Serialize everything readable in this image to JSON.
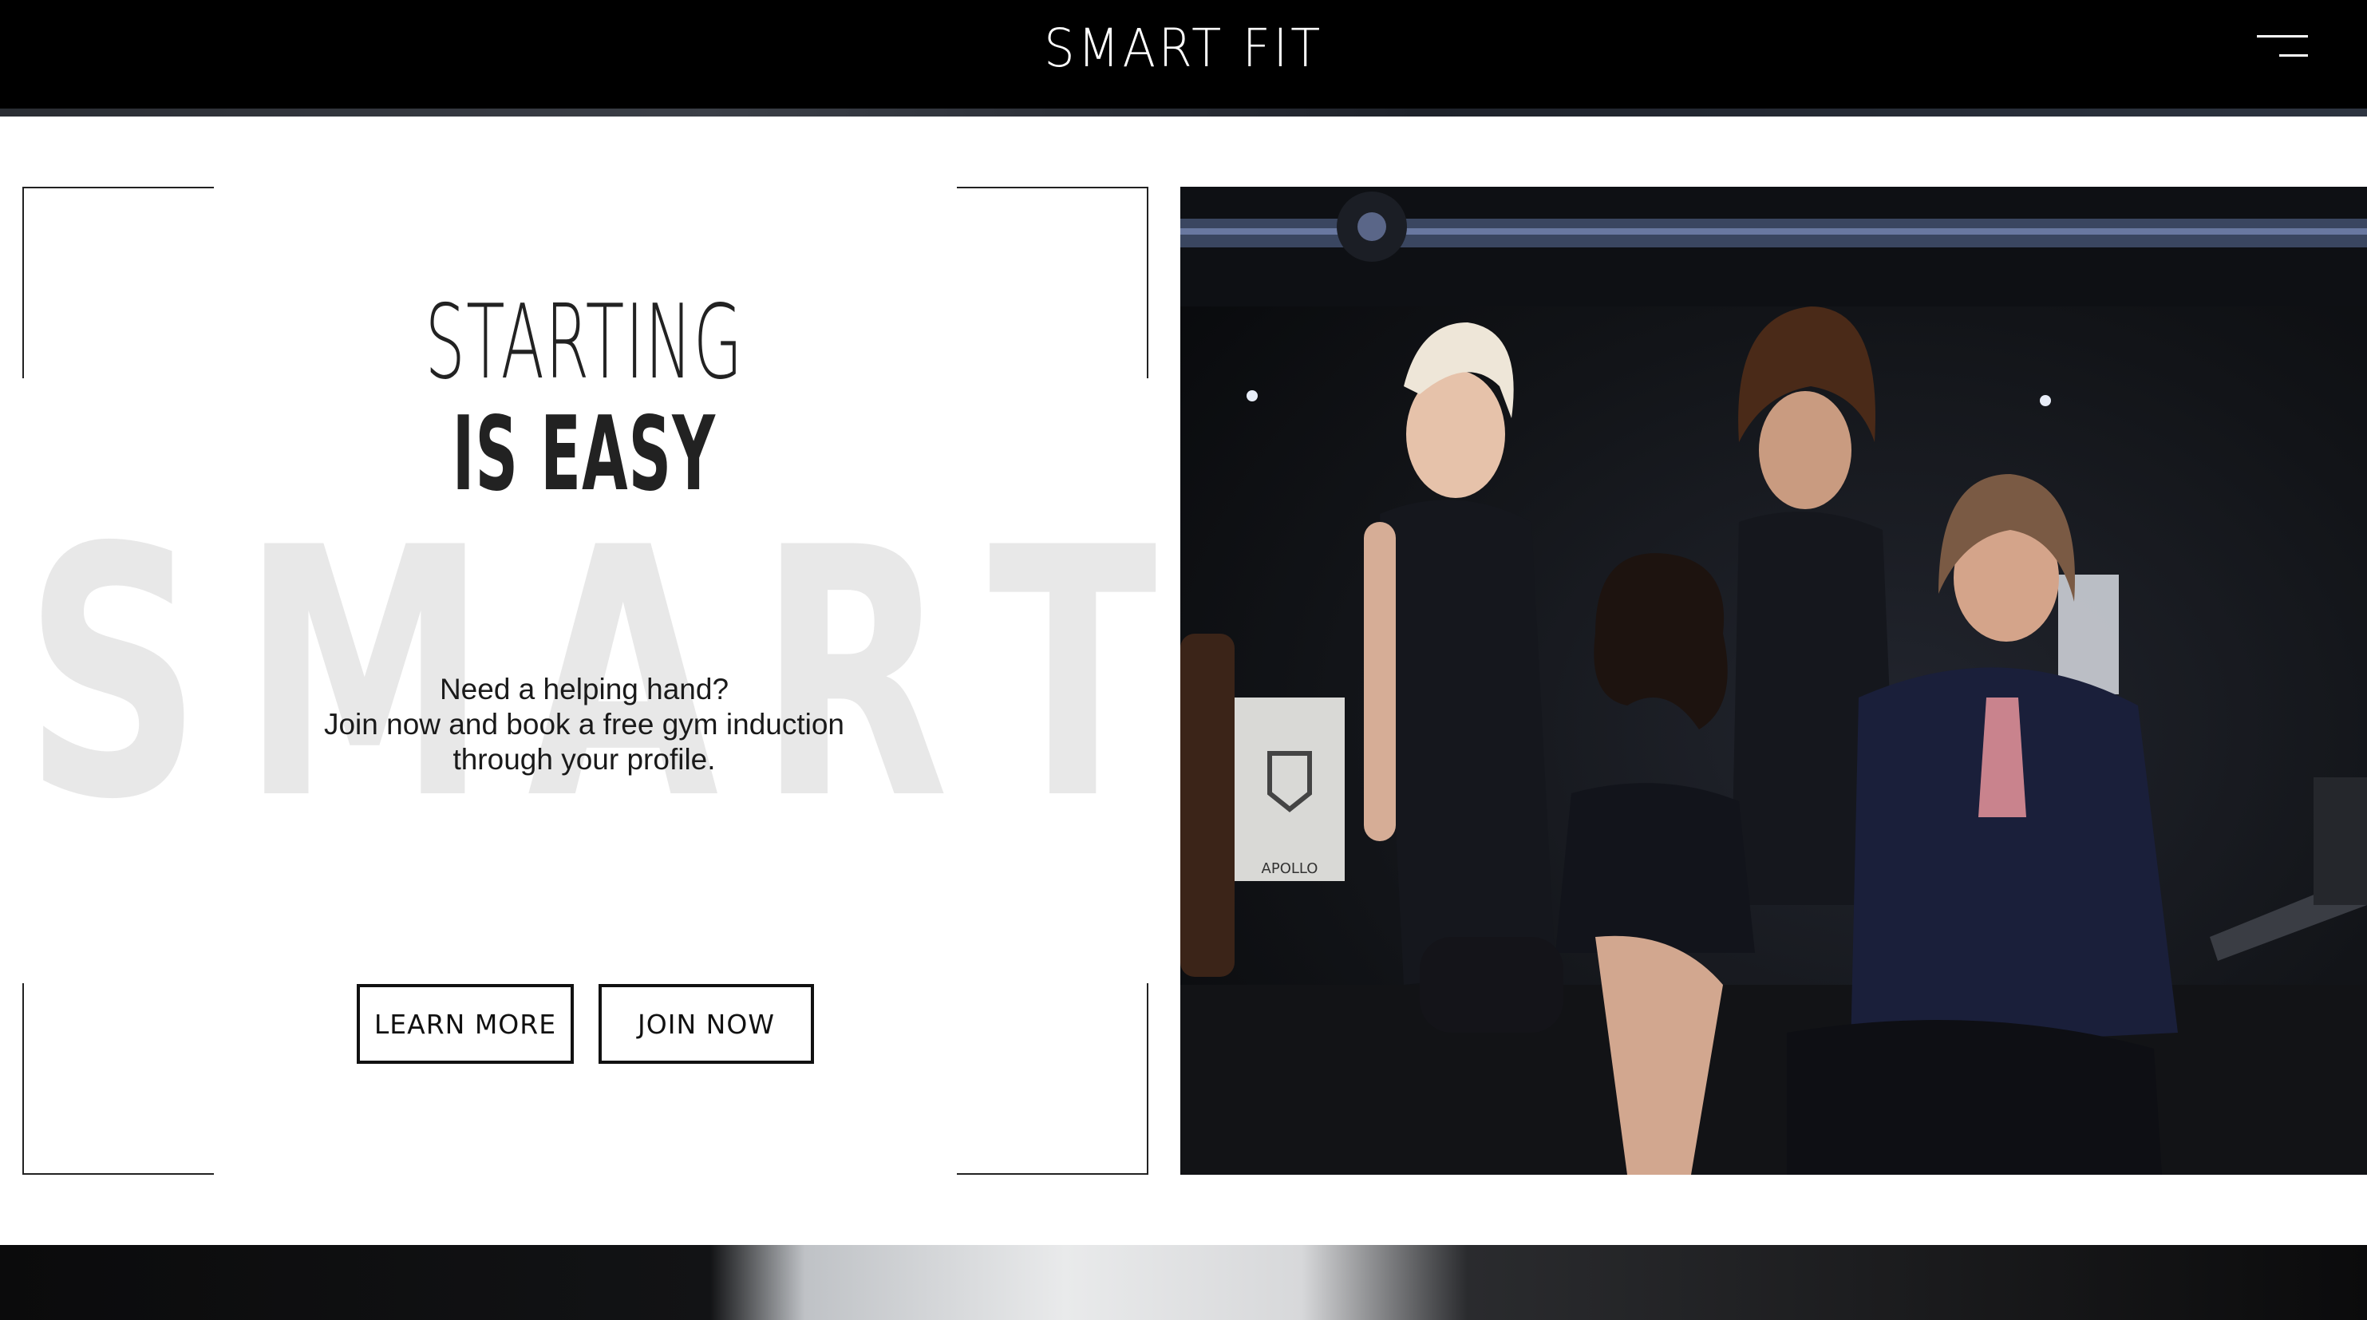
{
  "header": {
    "logo_text": "SMART FIT",
    "menu_icon": "hamburger-menu-icon"
  },
  "hero": {
    "watermark_letters": [
      "S",
      "M",
      "A",
      "R",
      "T"
    ],
    "headline_line1": "STARTING",
    "headline_line2": "IS EASY",
    "body_lines": [
      "Need a helping hand?",
      "Join now and book a free gym induction",
      "through your profile."
    ],
    "buttons": {
      "learn_more": "LEARN MORE",
      "join_now": "JOIN NOW"
    }
  },
  "photo": {
    "wall_sign_text": "APOLLO",
    "description_icon": "group-photo-image"
  },
  "colors": {
    "header_bg": "#000000",
    "text": "#222222",
    "watermark": "#e8e8e8",
    "page_bg": "#ffffff"
  }
}
